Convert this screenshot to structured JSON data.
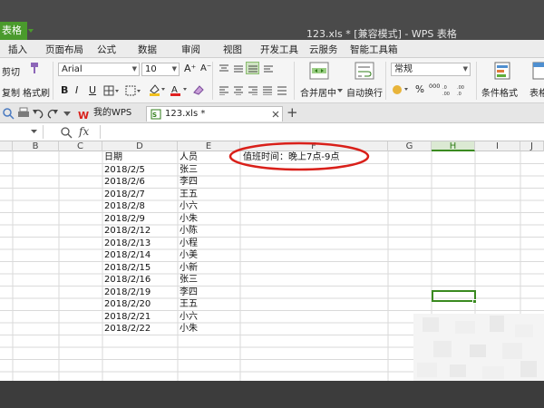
{
  "title_bar": {
    "app_button": "表格",
    "document_title": "123.xls * [兼容模式] - WPS 表格"
  },
  "menu": {
    "items": [
      "插入",
      "页面布局",
      "公式",
      "数据",
      "审阅",
      "视图",
      "开发工具",
      "云服务",
      "智能工具箱"
    ]
  },
  "ribbon": {
    "cut": "剪切",
    "copy": "复制",
    "format_painter": "格式刷",
    "font_name": "Arial",
    "font_size": "10",
    "merge_center": "合并居中",
    "wrap_text": "自动换行",
    "number_format": "常规",
    "conditional_format": "条件格式",
    "table_style": "表格",
    "grow_font": "A⁺",
    "shrink_font": "A⁻",
    "bold": "B",
    "italic": "I",
    "underline": "U",
    "percent": "%",
    "thousands": "000"
  },
  "tabs": {
    "my_wps": "我的WPS",
    "file_tab": "123.xls *",
    "new_tab": "+"
  },
  "formula_bar": {
    "fx": "fx"
  },
  "grid": {
    "columns": [
      "B",
      "C",
      "D",
      "E",
      "F",
      "G",
      "H",
      "I",
      "J"
    ],
    "selected_column": "H",
    "header_date": "日期",
    "header_person": "人员",
    "note": "值班时间：晚上7点-9点",
    "rows": [
      {
        "date": "2018/2/5",
        "person": "张三"
      },
      {
        "date": "2018/2/6",
        "person": "李四"
      },
      {
        "date": "2018/2/7",
        "person": "王五"
      },
      {
        "date": "2018/2/8",
        "person": "小六"
      },
      {
        "date": "2018/2/9",
        "person": "小朱"
      },
      {
        "date": "2018/2/12",
        "person": "小陈"
      },
      {
        "date": "2018/2/13",
        "person": "小程"
      },
      {
        "date": "2018/2/14",
        "person": "小美"
      },
      {
        "date": "2018/2/15",
        "person": "小新"
      },
      {
        "date": "2018/2/16",
        "person": "张三"
      },
      {
        "date": "2018/2/19",
        "person": "李四"
      },
      {
        "date": "2018/2/20",
        "person": "王五"
      },
      {
        "date": "2018/2/21",
        "person": "小六"
      },
      {
        "date": "2018/2/22",
        "person": "小朱"
      }
    ]
  },
  "colors": {
    "accent_green": "#3a8a20",
    "annotation_red": "#d9201a"
  }
}
